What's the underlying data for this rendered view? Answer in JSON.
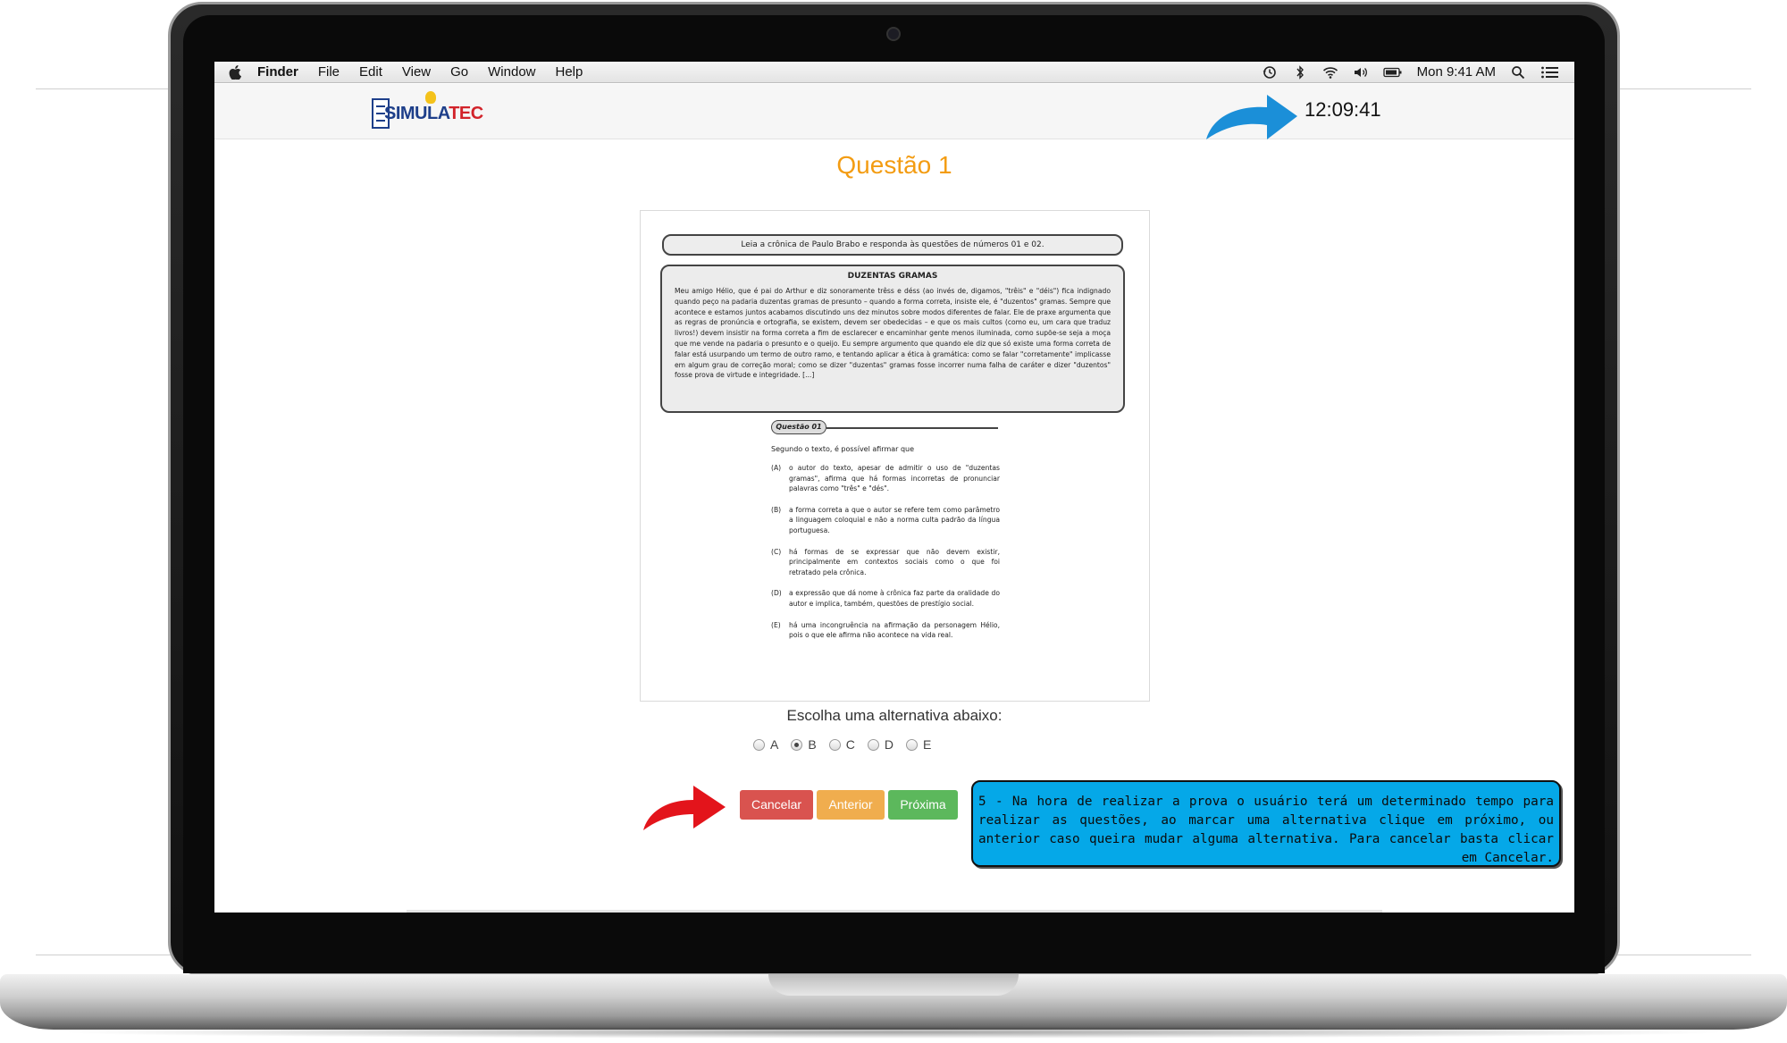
{
  "menubar": {
    "app_name": "Finder",
    "items": [
      "File",
      "Edit",
      "View",
      "Go",
      "Window",
      "Help"
    ],
    "clock": "Mon 9:41 AM"
  },
  "app": {
    "logo_text_1": "SIMULA",
    "logo_text_2": "TEC",
    "timer": "12:09:41",
    "question_title": "Questão 1",
    "choose_label": "Escolha uma alternativa abaixo:",
    "answer_options": [
      {
        "label": "A",
        "selected": false
      },
      {
        "label": "B",
        "selected": true
      },
      {
        "label": "C",
        "selected": false
      },
      {
        "label": "D",
        "selected": false
      },
      {
        "label": "E",
        "selected": false
      }
    ],
    "buttons": {
      "cancel": "Cancelar",
      "previous": "Anterior",
      "next": "Próxima"
    }
  },
  "question_image": {
    "instruction": "Leia a crônica de Paulo Brabo e responda às questões de números 01 e 02.",
    "passage_title": "DUZENTAS GRAMAS",
    "passage_body": "Meu amigo Hélio, que é pai do Arthur e diz sonoramente trêss e déss (ao invés de, digamos, \"trêis\" e \"déis\") fica indignado quando peço na padaria duzentas gramas de presunto – quando a forma correta, insiste ele, é \"duzentos\" gramas. Sempre que acontece e estamos juntos acabamos discutindo uns dez minutos sobre modos diferentes de falar. Ele de praxe argumenta que as regras de pronúncia e ortografia, se existem, devem ser obedecidas – e que os mais cultos (como eu, um cara que traduz livros!) devem insistir na forma correta a fim de esclarecer e encaminhar gente menos iluminada, como supõe-se seja a moça que me vende na padaria o presunto e o queijo. Eu sempre argumento que quando ele diz que só existe uma forma correta de falar está usurpando um termo de outro ramo, e tentando aplicar a ética à gramática: como se falar \"corretamente\" implicasse em algum grau de correção moral; como se dizer \"duzentas\" gramas fosse incorrer numa falha de caráter e dizer \"duzentos\" fosse prova de virtude e integridade. [...]",
    "question_tag": "Questão 01",
    "stem": "Segundo o texto, é possível afirmar que",
    "options": [
      {
        "letter": "(A)",
        "text": "o autor do texto, apesar de admitir o uso de \"duzentas gramas\", afirma que há formas incorretas de pronunciar palavras como \"três\" e \"dés\"."
      },
      {
        "letter": "(B)",
        "text": "a forma correta a que o autor se refere tem como parâmetro a linguagem coloquial e não a norma culta padrão da língua portuguesa."
      },
      {
        "letter": "(C)",
        "text": "há formas de se expressar que não devem existir, principalmente em contextos sociais como o que foi retratado pela crônica."
      },
      {
        "letter": "(D)",
        "text": "a expressão que dá nome à crônica faz parte da oralidade do autor e implica, também, questões de prestígio social."
      },
      {
        "letter": "(E)",
        "text": "há uma incongruência na afirmação da personagem Hélio, pois o que ele afirma não acontece na vida real."
      }
    ]
  },
  "callout": {
    "text": "5 - Na hora de realizar a prova o usuário terá um determinado tempo para realizar as questões, ao marcar uma alternativa clique em próximo, ou anterior caso queira mudar alguma alternativa. Para cancelar basta clicar em Cancelar."
  },
  "colors": {
    "title_orange": "#f39c12",
    "cancel_red": "#d9534f",
    "prev_orange": "#f0ad4e",
    "next_green": "#5cb85c",
    "callout_blue": "#05a8e8",
    "logo_blue": "#1e3f8a",
    "logo_red": "#d2232a"
  }
}
